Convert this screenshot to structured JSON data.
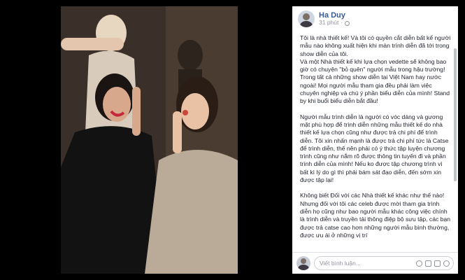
{
  "post": {
    "author": "Ha Duy",
    "time": "31 phút",
    "paragraphs": [
      "Tôi là nhà thiết kế! Và tôi có quyền cắt diễn bất kể người mẫu nào không xuất hiện khi màn trình diễn đã tới trong show diễn của tôi.\nVà một Nhà thiết kế khi lựa chọn vedette sẽ không bao giờ có chuyện \"bỏ quên\" người mẫu trong hậu trường!\nTrong tất cả những show diễn tại Việt Nam hay nước ngoài! Mọi người mẫu tham gia đều phải làm việc chuyên nghiệp và chú ý phần biểu diễn của mình! Stand by khi buổi biểu diễn bắt đầu!",
      "Người mẫu trình diễn là người có vóc dáng và gương mặt phù hợp để trình diễn những mẫu thiết kế do nhà thiết kế lựa chọn cũng như được trả chi phí để trình diễn. Tôi xin nhấn mạnh là được trả chi phí tức là Catse để trình diễn, thế nên phải có ý thức tập luyện chương trình cũng như nắm rõ được thông tin tuyến đi và phần trình diễn của mình! Nếu ko được tập chương trình vì bất kì lý do gì thì phải bám sát đạo diễn, đến sớm xin được tập lại!",
      "Không biết Đối với các Nhà thiết kế khác như thế nào! Nhưng đối với tôi các celeb được mời tham gia trình diễn họ cũng như bao người mẫu khác công việc chính là trình diễn và truyền tải thông điệp bộ sưu tập, các bạn được trả catse cao hơn những người mẫu bình thường, được ưu ái ở những vị trí"
    ]
  },
  "comment": {
    "placeholder": "Viết bình luận..."
  }
}
